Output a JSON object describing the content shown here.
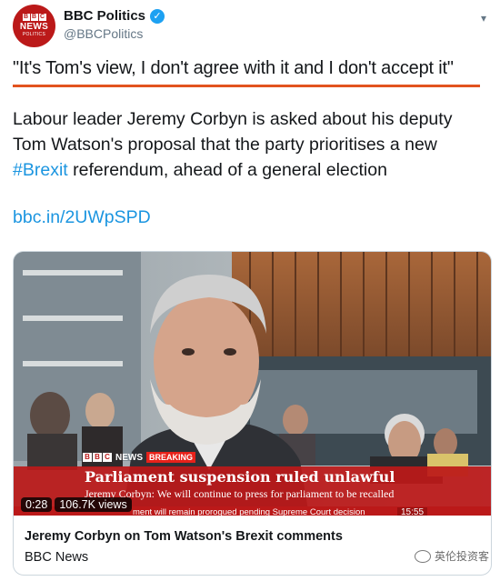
{
  "account": {
    "display_name": "BBC Politics",
    "handle": "@BBCPolitics",
    "avatar_news": "NEWS",
    "avatar_politics": "POLITICS",
    "bbc_letters": [
      "B",
      "B",
      "C"
    ]
  },
  "tweet": {
    "quote": "\"It's Tom's view, I don't agree with it and I don't accept it\"",
    "body_part1": "Labour leader Jeremy Corbyn is asked about his deputy Tom Watson's proposal that the party prioritises a new ",
    "hashtag": "#Brexit",
    "body_part2": " referendum, ahead of a general election",
    "link": "bbc.in/2UWpSPD"
  },
  "video": {
    "lower_third_news": "NEWS",
    "breaking": "BREAKING",
    "headline": "Parliament suspension ruled unlawful",
    "subheadline": "Jeremy Corbyn: We will continue to press for parliament to be recalled",
    "ticker": "ment will remain prorogued pending Supreme Court decision",
    "clock": "15:55",
    "duration": "0:28",
    "views": "106.7K views"
  },
  "card": {
    "title": "Jeremy Corbyn on Tom Watson's Brexit comments",
    "source": "BBC News"
  },
  "watermark": "英伦投资客",
  "colors": {
    "bbc_red": "#bb1919",
    "accent_orange": "#e2531f",
    "link_blue": "#1b95e0",
    "verified_blue": "#1da1f2"
  }
}
